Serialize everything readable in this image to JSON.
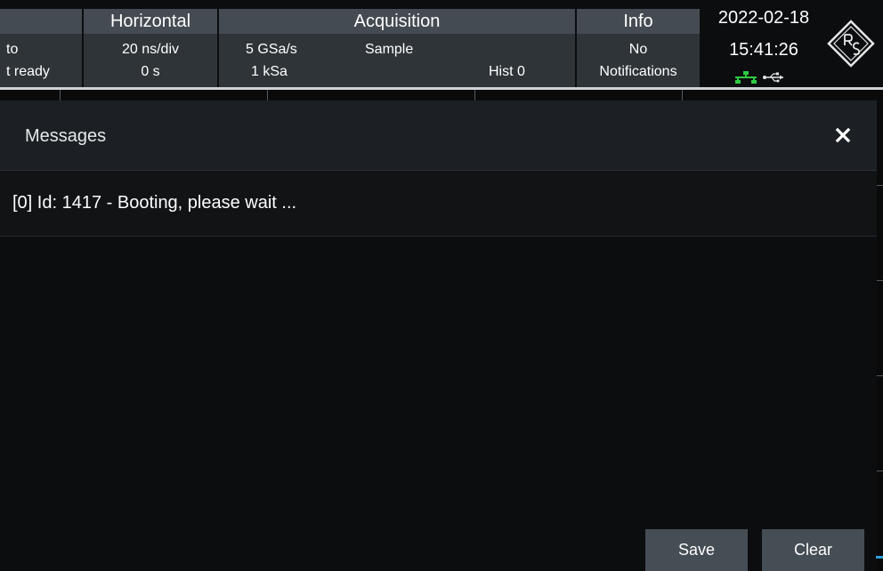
{
  "statusbar": {
    "trigger": {
      "line1": "to",
      "line2": "t ready"
    },
    "horizontal": {
      "title": "Horizontal",
      "scale": "20 ns/div",
      "position": "0 s"
    },
    "acquisition": {
      "title": "Acquisition",
      "sample_rate": "5 GSa/s",
      "record_length": "1 kSa",
      "mode": "Sample",
      "hist": "Hist 0"
    },
    "info": {
      "title": "Info",
      "line1": "No",
      "line2": "Notifications"
    },
    "datetime": {
      "date": "2022-02-18",
      "time": "15:41:26"
    }
  },
  "messages_dialog": {
    "title": "Messages",
    "messages": [
      "[0] Id: 1417 - Booting, please wait ..."
    ],
    "save_label": "Save",
    "clear_label": "Clear"
  },
  "icons": {
    "close": "close-icon",
    "network": "network-icon",
    "usb": "usb-icon",
    "logo": "rohde-schwarz-logo"
  },
  "colors": {
    "header_gray": "#454b52",
    "panel_gray": "#2f3439",
    "network_green": "#2ecc40",
    "button_gray": "#454d55"
  }
}
